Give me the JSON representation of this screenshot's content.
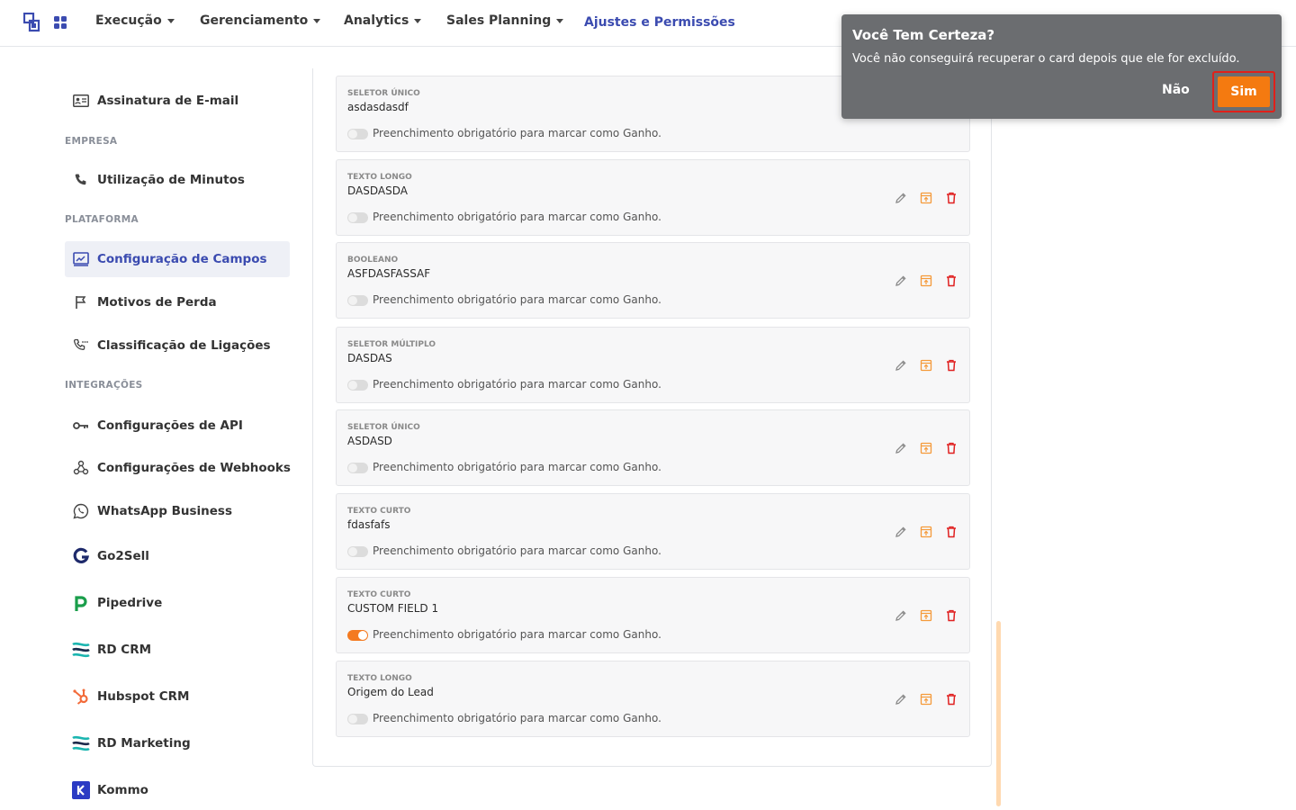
{
  "nav": {
    "items": [
      {
        "label": "Execução",
        "dropdown": true
      },
      {
        "label": "Gerenciamento",
        "dropdown": true
      },
      {
        "label": "Analytics",
        "dropdown": true
      },
      {
        "label": "Sales Planning",
        "dropdown": true
      },
      {
        "label": "Ajustes e Permissões",
        "active": true
      }
    ]
  },
  "sidebar": {
    "items": [
      {
        "label": "Assinatura de E-mail",
        "icon": "id-card-icon"
      },
      {
        "section": "EMPRESA"
      },
      {
        "label": "Utilização de Minutos",
        "icon": "phone-icon"
      },
      {
        "section": "PLATAFORMA"
      },
      {
        "label": "Configuração de Campos",
        "icon": "chart-box-icon",
        "active": true
      },
      {
        "label": "Motivos de Perda",
        "icon": "flag-icon"
      },
      {
        "label": "Classificação de Ligações",
        "icon": "phone-dots-icon"
      },
      {
        "section": "INTEGRAÇÕES"
      },
      {
        "label": "Configurações de API",
        "icon": "key-icon"
      },
      {
        "label": "Configurações de Webhooks",
        "icon": "webhook-icon"
      },
      {
        "label": "WhatsApp Business",
        "icon": "whatsapp-icon"
      },
      {
        "label": "Go2Sell",
        "icon": "go2sell-logo-icon"
      },
      {
        "label": "Pipedrive",
        "icon": "pipedrive-logo-icon"
      },
      {
        "label": "RD CRM",
        "icon": "rd-logo-icon"
      },
      {
        "label": "Hubspot CRM",
        "icon": "hubspot-logo-icon"
      },
      {
        "label": "RD Marketing",
        "icon": "rd-logo-icon"
      },
      {
        "label": "Kommo",
        "icon": "kommo-logo-icon"
      }
    ]
  },
  "fields": [
    {
      "type": "SELETOR ÚNICO",
      "name": "asdasdasdf",
      "required": false
    },
    {
      "type": "TEXTO LONGO",
      "name": "DASDASDA",
      "required": false
    },
    {
      "type": "BOOLEANO",
      "name": "ASFDASFASSAF",
      "required": false
    },
    {
      "type": "SELETOR MÚLTIPLO",
      "name": "DASDAS",
      "required": false
    },
    {
      "type": "SELETOR ÚNICO",
      "name": "ASDASD",
      "required": false
    },
    {
      "type": "TEXTO CURTO",
      "name": "fdasfafs",
      "required": false
    },
    {
      "type": "TEXTO CURTO",
      "name": "CUSTOM FIELD 1",
      "required": true
    },
    {
      "type": "TEXTO LONGO",
      "name": "Origem do Lead",
      "required": false
    }
  ],
  "required_label": "Preenchimento obrigatório para marcar como Ganho.",
  "colors": {
    "brand": "#3b4bb0",
    "accent": "#f47a10",
    "danger": "#e0201a",
    "dialog_bg": "#6b6d70"
  },
  "dialog": {
    "title": "Você Tem Certeza?",
    "message": "Você não conseguirá recuperar o card depois que ele for excluído.",
    "no_label": "Não",
    "yes_label": "Sim"
  }
}
